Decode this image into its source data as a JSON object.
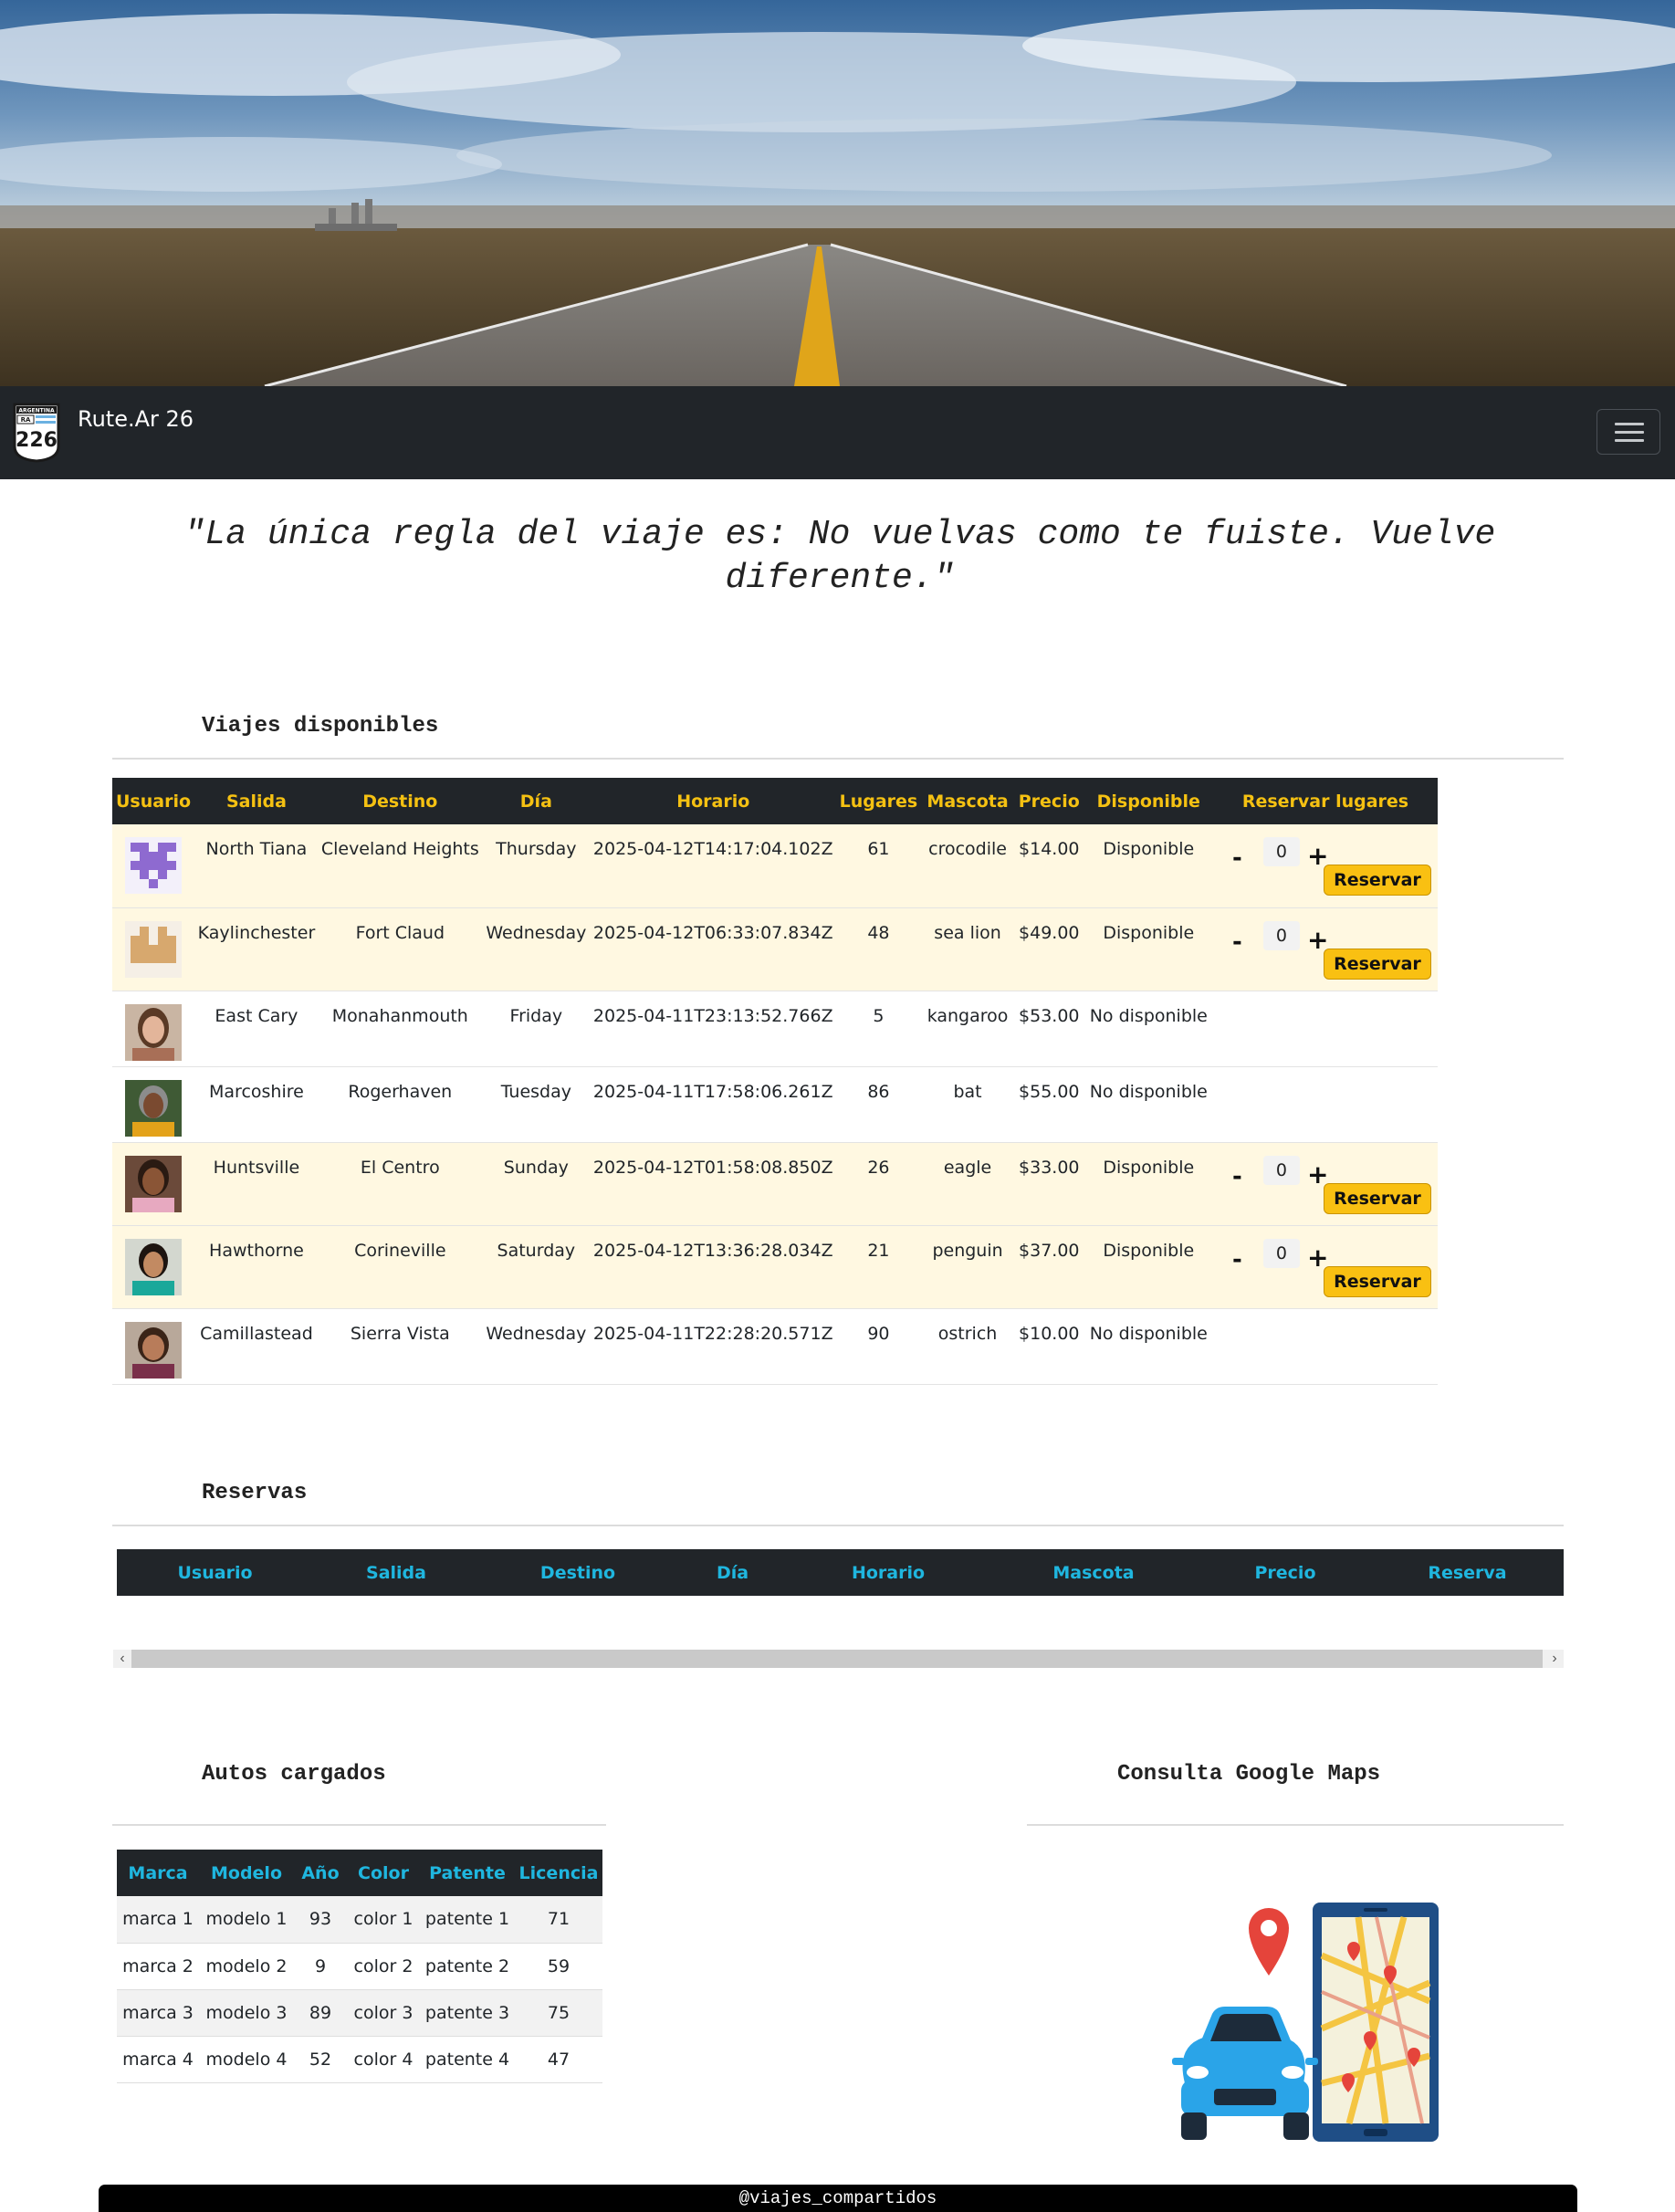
{
  "navbar": {
    "brand": "Rute.Ar 26",
    "logo": {
      "top": "ARGENTINA",
      "tag": "RA",
      "number": "226"
    }
  },
  "quote": "\"La única regla del viaje es: No vuelvas como te fuiste. Vuelve diferente.\"",
  "trips": {
    "title": "Viajes disponibles",
    "headers": [
      "Usuario",
      "Salida",
      "Destino",
      "Día",
      "Horario",
      "Lugares",
      "Mascota",
      "Precio",
      "Disponible",
      "Reservar lugares"
    ],
    "rows": [
      {
        "avatar": "identicon-purple",
        "salida": "North Tiana",
        "destino": "Cleveland Heights",
        "dia": "Thursday",
        "horario": "2025-04-12T14:17:04.102Z",
        "lugares": "61",
        "mascota": "crocodile",
        "precio": "$14.00",
        "disponible": "Disponible",
        "qty": "0",
        "btn": "Reservar"
      },
      {
        "avatar": "identicon-tan",
        "salida": "Kaylinchester",
        "destino": "Fort Claud",
        "dia": "Wednesday",
        "horario": "2025-04-12T06:33:07.834Z",
        "lugares": "48",
        "mascota": "sea lion",
        "precio": "$49.00",
        "disponible": "Disponible",
        "qty": "0",
        "btn": "Reservar"
      },
      {
        "avatar": "photo-woman-1",
        "salida": "East Cary",
        "destino": "Monahanmouth",
        "dia": "Friday",
        "horario": "2025-04-11T23:13:52.766Z",
        "lugares": "5",
        "mascota": "kangaroo",
        "precio": "$53.00",
        "disponible": "No disponible"
      },
      {
        "avatar": "photo-woman-2",
        "salida": "Marcoshire",
        "destino": "Rogerhaven",
        "dia": "Tuesday",
        "horario": "2025-04-11T17:58:06.261Z",
        "lugares": "86",
        "mascota": "bat",
        "precio": "$55.00",
        "disponible": "No disponible"
      },
      {
        "avatar": "photo-woman-3",
        "salida": "Huntsville",
        "destino": "El Centro",
        "dia": "Sunday",
        "horario": "2025-04-12T01:58:08.850Z",
        "lugares": "26",
        "mascota": "eagle",
        "precio": "$33.00",
        "disponible": "Disponible",
        "qty": "0",
        "btn": "Reservar"
      },
      {
        "avatar": "photo-woman-4",
        "salida": "Hawthorne",
        "destino": "Corineville",
        "dia": "Saturday",
        "horario": "2025-04-12T13:36:28.034Z",
        "lugares": "21",
        "mascota": "penguin",
        "precio": "$37.00",
        "disponible": "Disponible",
        "qty": "0",
        "btn": "Reservar"
      },
      {
        "avatar": "photo-woman-5",
        "salida": "Camillastead",
        "destino": "Sierra Vista",
        "dia": "Wednesday",
        "horario": "2025-04-11T22:28:20.571Z",
        "lugares": "90",
        "mascota": "ostrich",
        "precio": "$10.00",
        "disponible": "No disponible"
      }
    ],
    "minus": "-",
    "plus": "+"
  },
  "reservas": {
    "title": "Reservas",
    "headers": [
      "Usuario",
      "Salida",
      "Destino",
      "Día",
      "Horario",
      "Mascota",
      "Precio",
      "Reserva"
    ],
    "scroll_left": "‹",
    "scroll_right": "›"
  },
  "autos": {
    "title": "Autos cargados",
    "headers": [
      "Marca",
      "Modelo",
      "Año",
      "Color",
      "Patente",
      "Licencia"
    ],
    "rows": [
      [
        "marca 1",
        "modelo 1",
        "93",
        "color 1",
        "patente 1",
        "71"
      ],
      [
        "marca 2",
        "modelo 2",
        "9",
        "color 2",
        "patente 2",
        "59"
      ],
      [
        "marca 3",
        "modelo 3",
        "89",
        "color 3",
        "patente 3",
        "75"
      ],
      [
        "marca 4",
        "modelo 4",
        "52",
        "color 4",
        "patente 4",
        "47"
      ]
    ]
  },
  "maps": {
    "title": "Consulta Google Maps",
    "illustration": "car-and-phone-map-icon"
  },
  "footer": "@viajes_compartidos",
  "colors": {
    "navbar": "#212529",
    "accent_yellow": "#f5c112",
    "accent_cyan": "#1fb6df",
    "row_highlight": "#fff8e1",
    "button": "#f9c012"
  }
}
